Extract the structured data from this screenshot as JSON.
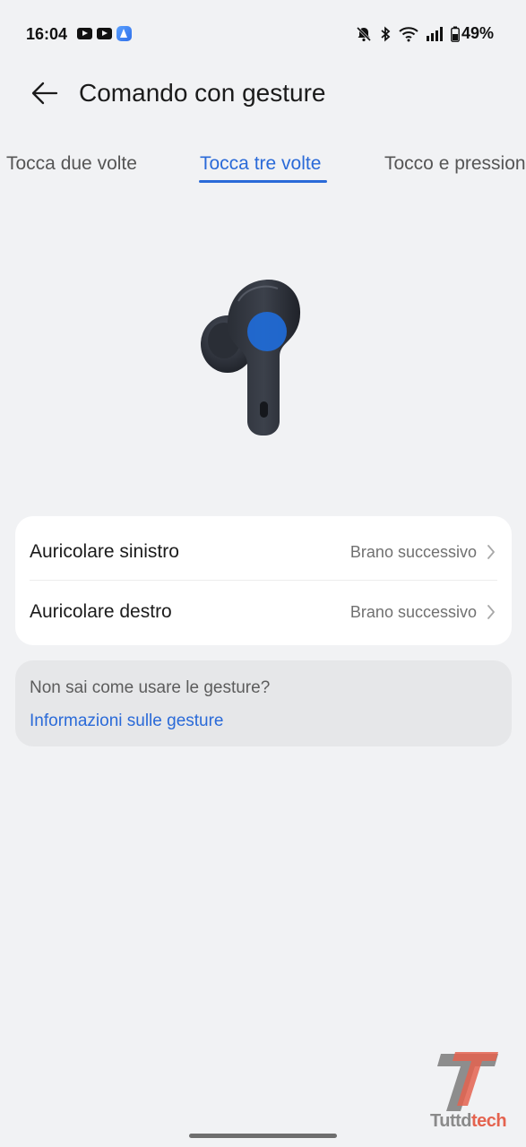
{
  "status_bar": {
    "time": "16:04",
    "battery": "49%",
    "icons": [
      "youtube-icon",
      "youtube-icon",
      "app-a-icon",
      "mute-bell-icon",
      "bluetooth-icon",
      "wifi-icon",
      "signal-icon",
      "battery-icon"
    ]
  },
  "header": {
    "title": "Comando con gesture",
    "back_icon": "arrow-left-icon"
  },
  "tabs": [
    {
      "label": "Tocca due volte",
      "selected": false
    },
    {
      "label": "Tocca tre volte",
      "selected": true
    },
    {
      "label": "Tocco e pressione",
      "selected": false
    }
  ],
  "settings": [
    {
      "label": "Auricolare sinistro",
      "value": "Brano successivo"
    },
    {
      "label": "Auricolare destro",
      "value": "Brano successivo"
    }
  ],
  "help": {
    "question": "Non sai come usare le gesture?",
    "link": "Informazioni sulle gesture"
  },
  "watermark": {
    "text_main": "Tuttd",
    "text_accent": "tech"
  },
  "colors": {
    "accent": "#2a6ad8",
    "background": "#f1f2f4",
    "card": "#ffffff",
    "help_card": "#e6e7e9"
  }
}
